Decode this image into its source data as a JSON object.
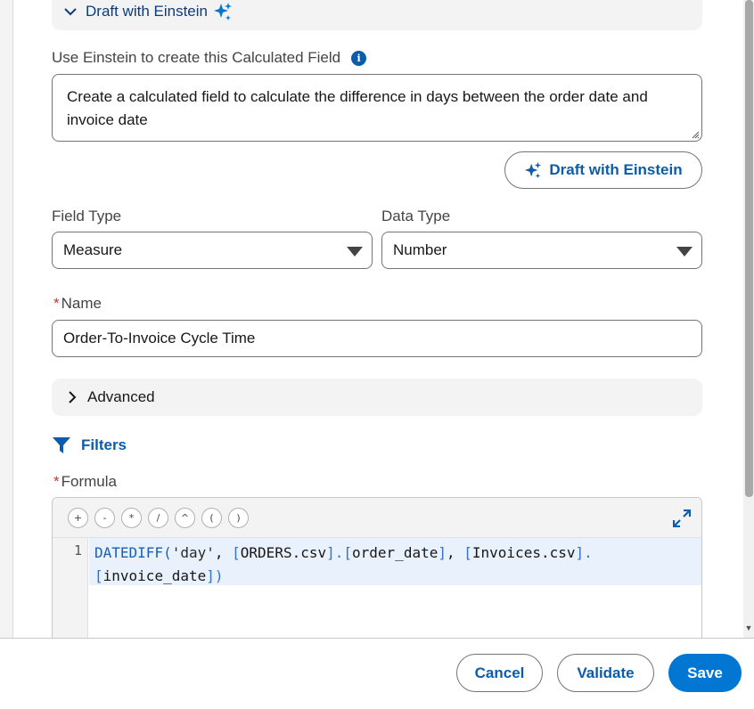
{
  "einstein_section": {
    "title": "Draft with Einstein",
    "prompt_label": "Use Einstein to create this Calculated Field",
    "prompt_value": "Create a calculated field to calculate the difference in days between the order date and invoice date",
    "draft_button": "Draft with Einstein"
  },
  "field_type": {
    "label": "Field Type",
    "value": "Measure"
  },
  "data_type": {
    "label": "Data Type",
    "value": "Number"
  },
  "name": {
    "label": "Name",
    "required_marker": "*",
    "value": "Order-To-Invoice Cycle Time"
  },
  "advanced": {
    "label": "Advanced"
  },
  "filters": {
    "label": "Filters"
  },
  "formula": {
    "label": "Formula",
    "required_marker": "*",
    "operators": [
      "+",
      "-",
      "*",
      "/",
      "^",
      "(",
      ")"
    ],
    "line_number": "1",
    "code_line1": {
      "fn": "DATEDIFF(",
      "arg1": "'day'",
      "sep1": ", ",
      "t1_open": "[",
      "t1": "ORDERS.csv",
      "t1_close": "].",
      "c1_open": "[",
      "c1": "order_date",
      "c1_close": "]",
      "sep2": ", ",
      "t2_open": "[",
      "t2": "Invoices.csv",
      "t2_close": "]."
    },
    "code_line2": {
      "c2_open": "[",
      "c2": "invoice_date",
      "c2_close": "])"
    }
  },
  "footer": {
    "cancel": "Cancel",
    "validate": "Validate",
    "save": "Save"
  },
  "colors": {
    "brand_blue": "#0176d3",
    "link_blue": "#0b5cab",
    "required_red": "#c23934"
  }
}
